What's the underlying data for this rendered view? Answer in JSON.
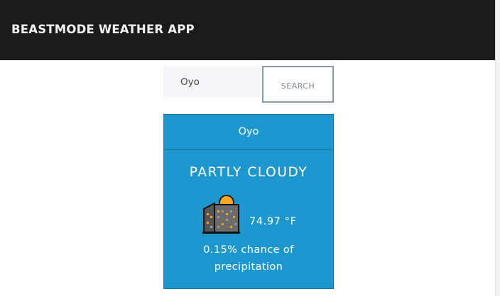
{
  "navbar": {
    "title": "BEASTMODE WEATHER APP"
  },
  "search": {
    "value": "Oyo",
    "button_label": "SEARCH"
  },
  "weather_card": {
    "city": "Oyo",
    "condition": "PARTLY CLOUDY",
    "icon": "night-city-with-sun-icon",
    "temperature": "74.97 °F",
    "precipitation_line1": "0.15% chance of",
    "precipitation_line2": "precipitation"
  },
  "colors": {
    "navbar_bg": "#1b1b1b",
    "card_bg": "#1e97cf",
    "button_border": "#8a9aa6",
    "sun": "#f5a623"
  }
}
